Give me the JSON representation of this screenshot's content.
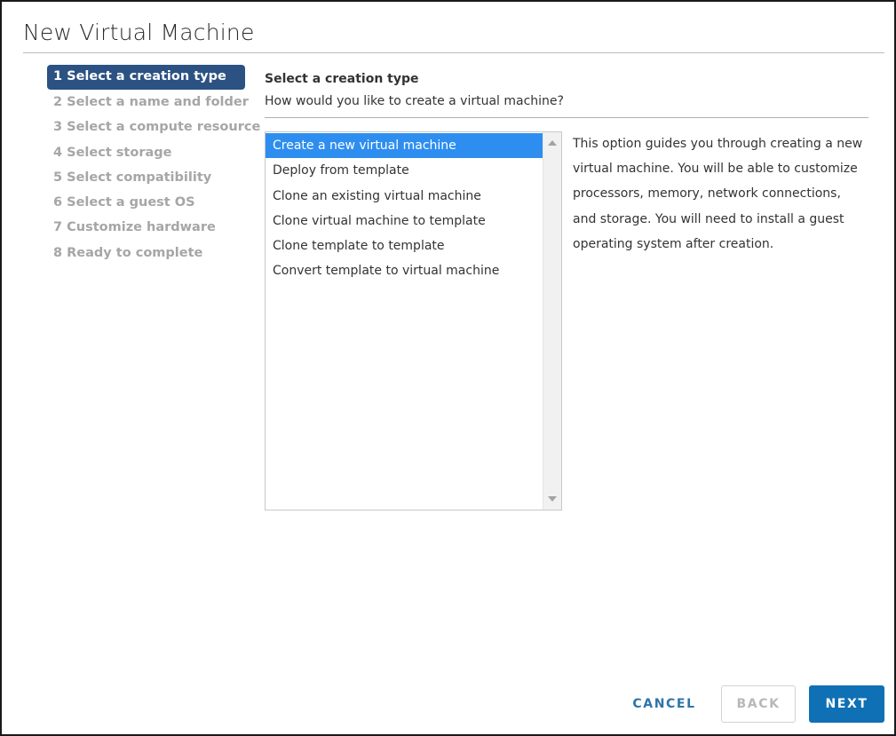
{
  "window": {
    "title": "New Virtual Machine"
  },
  "steps": [
    {
      "label": "1 Select a creation type",
      "active": true
    },
    {
      "label": "2 Select a name and folder",
      "active": false
    },
    {
      "label": "3 Select a compute resource",
      "active": false
    },
    {
      "label": "4 Select storage",
      "active": false
    },
    {
      "label": "5 Select compatibility",
      "active": false
    },
    {
      "label": "6 Select a guest OS",
      "active": false
    },
    {
      "label": "7 Customize hardware",
      "active": false
    },
    {
      "label": "8 Ready to complete",
      "active": false
    }
  ],
  "content": {
    "heading": "Select a creation type",
    "question": "How would you like to create a virtual machine?",
    "options": [
      {
        "label": "Create a new virtual machine",
        "selected": true
      },
      {
        "label": "Deploy from template",
        "selected": false
      },
      {
        "label": "Clone an existing virtual machine",
        "selected": false
      },
      {
        "label": "Clone virtual machine to template",
        "selected": false
      },
      {
        "label": "Clone template to template",
        "selected": false
      },
      {
        "label": "Convert template to virtual machine",
        "selected": false
      }
    ],
    "description": "This option guides you through creating a new virtual machine. You will be able to customize processors, memory, network connections, and storage. You will need to install a guest operating system after creation."
  },
  "footer": {
    "cancel_label": "CANCEL",
    "back_label": "BACK",
    "next_label": "NEXT",
    "back_enabled": false
  },
  "colors": {
    "active_step_bg": "#2b5282",
    "selected_option_bg": "#2d8ef0",
    "primary_button_bg": "#0f70b5",
    "link_button_text": "#2f74a8",
    "disabled_text": "#a6a6a6"
  }
}
